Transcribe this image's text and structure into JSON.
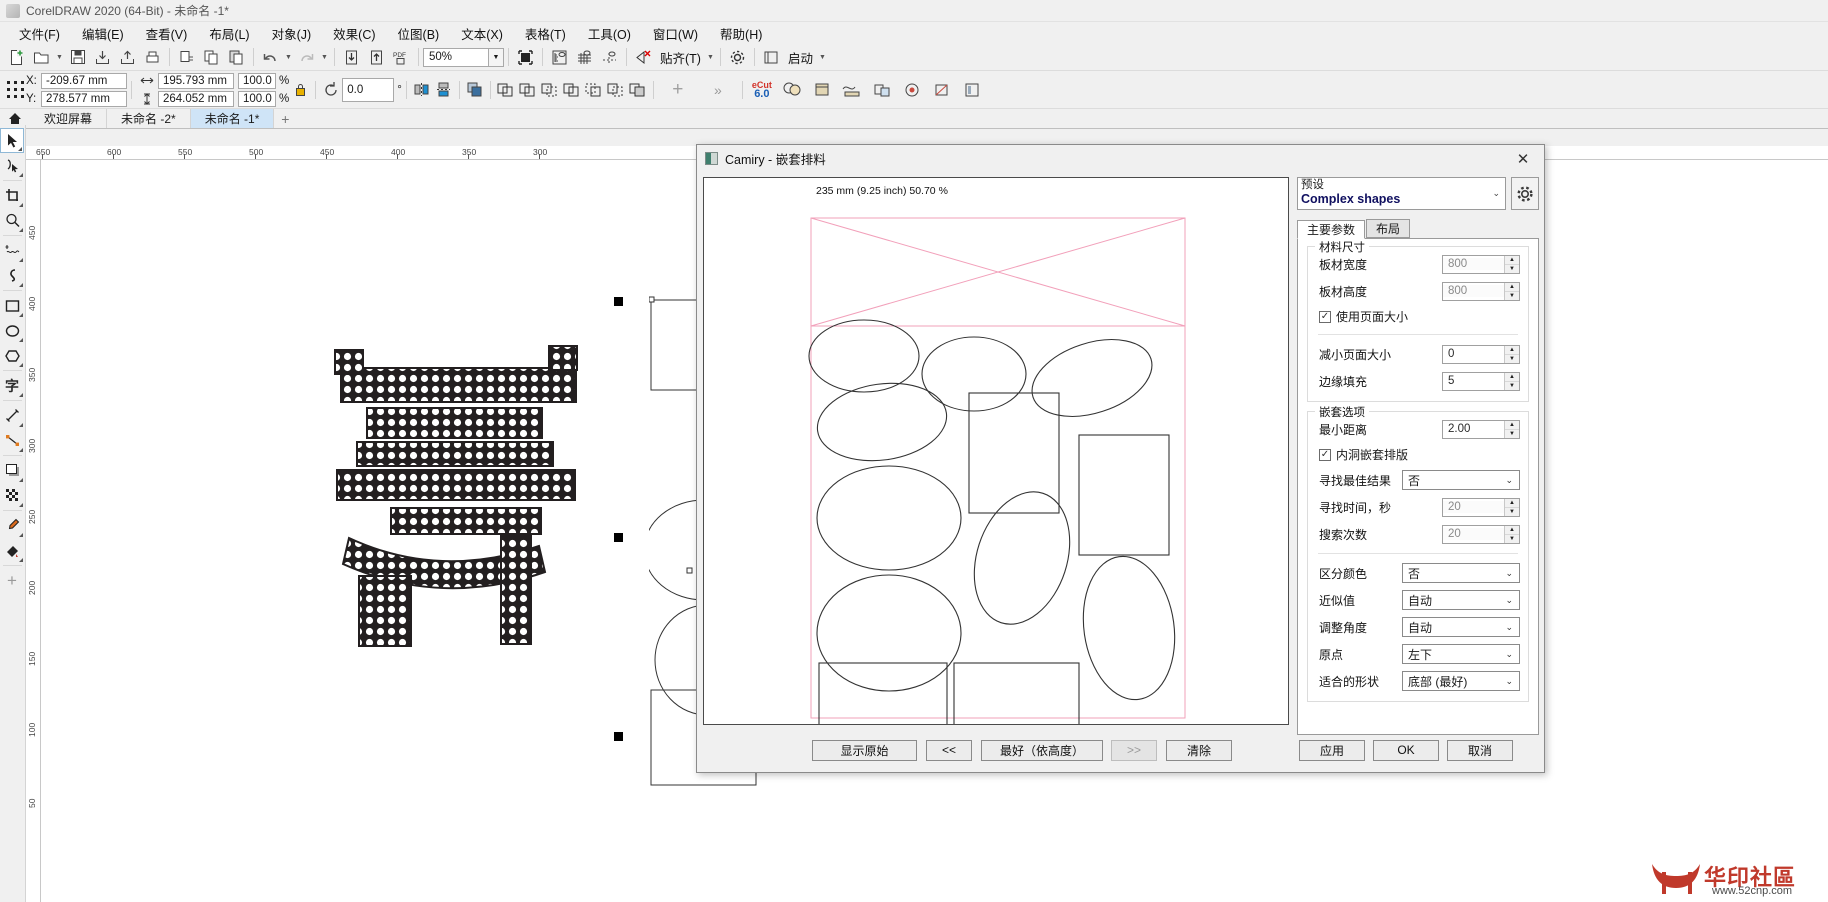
{
  "app": {
    "title": "CorelDRAW 2020 (64-Bit) - 未命名 -1*",
    "logo_icon": "coreldraw-balloon-icon"
  },
  "menubar": {
    "items": [
      {
        "label": "文件(F)",
        "name": "menu-file"
      },
      {
        "label": "编辑(E)",
        "name": "menu-edit"
      },
      {
        "label": "查看(V)",
        "name": "menu-view"
      },
      {
        "label": "布局(L)",
        "name": "menu-layout"
      },
      {
        "label": "对象(J)",
        "name": "menu-object"
      },
      {
        "label": "效果(C)",
        "name": "menu-effects"
      },
      {
        "label": "位图(B)",
        "name": "menu-bitmap"
      },
      {
        "label": "文本(X)",
        "name": "menu-text"
      },
      {
        "label": "表格(T)",
        "name": "menu-table"
      },
      {
        "label": "工具(O)",
        "name": "menu-tools"
      },
      {
        "label": "窗口(W)",
        "name": "menu-window"
      },
      {
        "label": "帮助(H)",
        "name": "menu-help"
      }
    ]
  },
  "toolbar": {
    "zoom_level": "50%",
    "snap_label": "贴齐(T)",
    "launch_label": "启动",
    "icons": [
      "new-document-icon",
      "open-folder-icon",
      "save-icon",
      "import-icon",
      "export-icon",
      "print-icon",
      "publish-pdf-icon",
      "copy-icon",
      "paste-icon",
      "undo-icon",
      "redo-icon",
      "import-arrow-icon",
      "export-arrow-icon",
      "pdf-icon",
      "full-screen-preview-icon",
      "rulers-icon",
      "grid-icon",
      "guidelines-icon",
      "snap-off-icon",
      "options-gear-icon",
      "launch-icon"
    ]
  },
  "propertybar": {
    "position_x_label": "X:",
    "position_y_label": "Y:",
    "position_x": "-209.67 mm",
    "position_y": "278.577 mm",
    "width": "195.793 mm",
    "height": "264.052 mm",
    "scale_x": "100.0",
    "scale_y": "100.0",
    "percent": "%",
    "rotation": "0.0",
    "degree_symbol": "°",
    "plugin_name": "eCut",
    "plugin_version": "6.0"
  },
  "tabbar": {
    "home_icon": "home-icon",
    "add_icon": "add-page-icon",
    "tabs": [
      {
        "label": "欢迎屏幕",
        "active": false
      },
      {
        "label": "未命名 -2*",
        "active": false
      },
      {
        "label": "未命名 -1*",
        "active": true
      }
    ]
  },
  "lefttools": [
    {
      "name": "pick-tool",
      "icon": "arrow-cursor-icon",
      "selected": true
    },
    {
      "name": "shape-tool",
      "icon": "node-edit-icon",
      "selected": false
    },
    {
      "name": "crop-tool",
      "icon": "crop-icon",
      "selected": false
    },
    {
      "name": "zoom-tool",
      "icon": "magnifier-icon",
      "selected": false
    },
    {
      "name": "freehand-tool",
      "icon": "freehand-curve-icon",
      "selected": false
    },
    {
      "name": "artistic-media-tool",
      "icon": "artistic-media-icon",
      "selected": false
    },
    {
      "name": "rectangle-tool",
      "icon": "rectangle-icon",
      "selected": false
    },
    {
      "name": "ellipse-tool",
      "icon": "ellipse-icon",
      "selected": false
    },
    {
      "name": "polygon-tool",
      "icon": "polygon-icon",
      "selected": false
    },
    {
      "name": "text-tool",
      "icon": "text-character-icon",
      "selected": false
    },
    {
      "name": "parallel-dimension-tool",
      "icon": "dimension-line-icon",
      "selected": false
    },
    {
      "name": "connector-tool",
      "icon": "straight-connector-icon",
      "selected": false
    },
    {
      "name": "drop-shadow-tool",
      "icon": "drop-shadow-icon",
      "selected": false
    },
    {
      "name": "transparency-tool",
      "icon": "checkerboard-transparency-icon",
      "selected": false
    },
    {
      "name": "color-eyedropper-tool",
      "icon": "eyedropper-icon",
      "selected": false
    },
    {
      "name": "interactive-fill-tool",
      "icon": "paint-bucket-icon",
      "selected": false
    },
    {
      "name": "customize-toolbox",
      "icon": "plus-icon",
      "selected": false
    }
  ],
  "rulers": {
    "horizontal_ticks": [
      "650",
      "600",
      "550",
      "500",
      "450",
      "400",
      "350",
      "300"
    ],
    "vertical_ticks": [
      "450",
      "400",
      "350",
      "300",
      "250",
      "200",
      "150",
      "100",
      "50"
    ]
  },
  "dialog": {
    "title": "Camiry - 嵌套排料",
    "icon": "nesting-app-icon",
    "close_icon": "close-icon",
    "preview": {
      "dimension_label": "235 mm (9.25 inch)  50.70 %",
      "sheet_color": "#f5a6bd",
      "shape_color": "#333333"
    },
    "preset": {
      "label": "预设",
      "value": "Complex shapes",
      "caret_icon": "chevron-down-icon",
      "gear_icon": "gear-icon"
    },
    "tabs": [
      {
        "label": "主要参数",
        "active": true
      },
      {
        "label": "布局",
        "active": false
      }
    ],
    "material_group": {
      "title": "材料尺寸",
      "fields": [
        {
          "label": "板材宽度",
          "value": "800",
          "type": "spin",
          "disabled": true
        },
        {
          "label": "板材高度",
          "value": "800",
          "type": "spin",
          "disabled": true
        }
      ],
      "checkbox": {
        "label": "使用页面大小",
        "checked": true
      },
      "fields2": [
        {
          "label": "减小页面大小",
          "value": "0",
          "type": "spin",
          "disabled": false
        },
        {
          "label": "边缘填充",
          "value": "5",
          "type": "spin",
          "disabled": false
        }
      ]
    },
    "nesting_group": {
      "title": "嵌套选项",
      "min_distance": {
        "label": "最小距离",
        "value": "2.00"
      },
      "checkbox": {
        "label": "内洞嵌套排版",
        "checked": true
      },
      "fields": [
        {
          "label": "寻找最佳结果",
          "value": "否",
          "type": "combo"
        },
        {
          "label": "寻找时间，秒",
          "value": "20",
          "type": "spin",
          "disabled": true
        },
        {
          "label": "搜索次数",
          "value": "20",
          "type": "spin",
          "disabled": true
        }
      ],
      "fields2": [
        {
          "label": "区分颜色",
          "value": "否",
          "type": "combo"
        },
        {
          "label": "近似值",
          "value": "自动",
          "type": "combo"
        },
        {
          "label": "调整角度",
          "value": "自动",
          "type": "combo"
        },
        {
          "label": "原点",
          "value": "左下",
          "type": "combo"
        },
        {
          "label": "适合的形状",
          "value": "底部 (最好)",
          "type": "combo"
        }
      ]
    },
    "buttons": {
      "show_original": "显示原始",
      "prev": "<<",
      "best": "最好（依高度）",
      "next": ">>",
      "clear": "清除",
      "apply": "应用",
      "ok": "OK",
      "cancel": "取消"
    }
  },
  "watermark": {
    "text": "华印社區",
    "url": "www.52cnp.com"
  }
}
